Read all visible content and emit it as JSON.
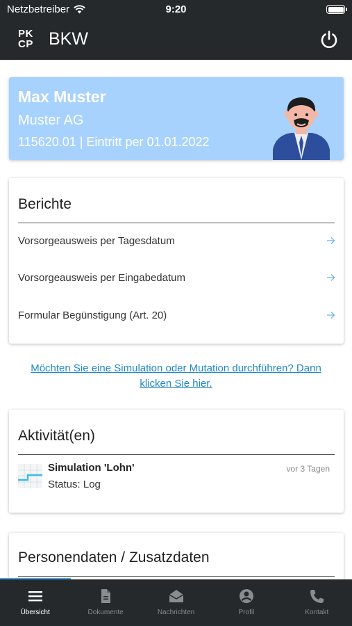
{
  "status_bar": {
    "carrier": "Netzbetreiber",
    "time": "9:20",
    "battery_level": 1.0
  },
  "app_bar": {
    "logo_line1": "PK",
    "logo_line2": "CP",
    "title": "BKW"
  },
  "profile": {
    "name": "Max Muster",
    "company": "Muster AG",
    "details": "115620.01 | Eintritt per 01.01.2022"
  },
  "reports": {
    "title": "Berichte",
    "items": [
      {
        "label": "Vorsorgeausweis per Tagesdatum"
      },
      {
        "label": "Vorsorgeausweis per Eingabedatum"
      },
      {
        "label": "Formular Begünstigung (Art. 20)"
      }
    ]
  },
  "simulation_link": {
    "line1": "Möchten Sie eine Simulation oder Mutation durchführen? Dann",
    "line2": "klicken Sie hier."
  },
  "activities": {
    "title": "Aktivität(en)",
    "items": [
      {
        "title": "Simulation 'Lohn'",
        "status": "Status: Log",
        "time": "vor 3 Tagen"
      }
    ]
  },
  "personal": {
    "title": "Personendaten / Zusatzdaten"
  },
  "tab_bar": {
    "tabs": [
      {
        "label": "Übersicht",
        "icon": "menu-icon",
        "active": true
      },
      {
        "label": "Dokumente",
        "icon": "document-icon",
        "active": false
      },
      {
        "label": "Nachrichten",
        "icon": "envelope-icon",
        "active": false
      },
      {
        "label": "Profil",
        "icon": "account-icon",
        "active": false
      },
      {
        "label": "Kontakt",
        "icon": "phone-icon",
        "active": false
      }
    ]
  },
  "colors": {
    "header_bg": "#26292c",
    "profile_bg": "#a7d2fd",
    "link": "#1e88c9",
    "arrow": "#6fb2e8"
  }
}
